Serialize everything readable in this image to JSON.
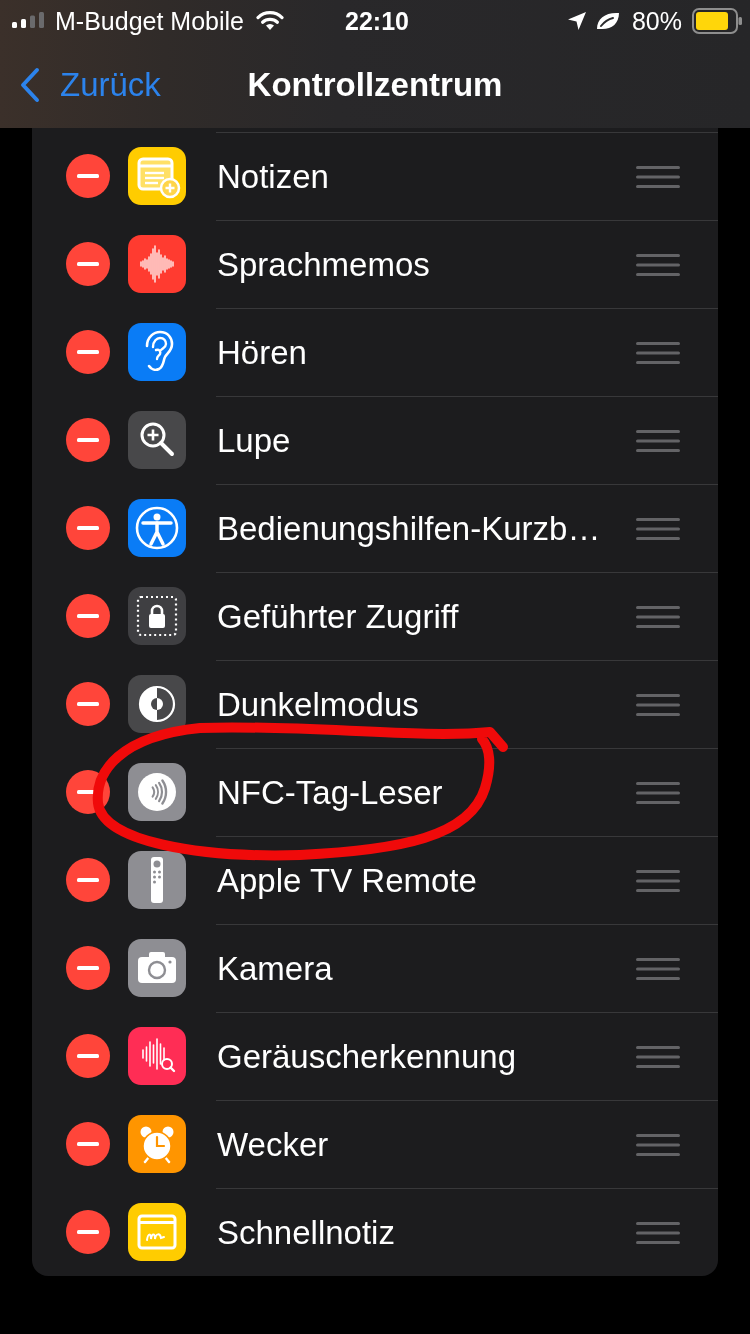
{
  "status_bar": {
    "carrier": "M-Budget Mobile",
    "time": "22:10",
    "battery": "80%"
  },
  "nav": {
    "back": "Zurück",
    "title": "Kontrollzentrum"
  },
  "items": [
    {
      "label": "Notizen",
      "kind": "notes",
      "circled": false
    },
    {
      "label": "Sprachmemos",
      "kind": "memos",
      "circled": false
    },
    {
      "label": "Hören",
      "kind": "hearing",
      "circled": false
    },
    {
      "label": "Lupe",
      "kind": "magnifier",
      "circled": false
    },
    {
      "label": "Bedienungshilfen-Kurzb…",
      "kind": "accessibility",
      "circled": false
    },
    {
      "label": "Geführter Zugriff",
      "kind": "guided",
      "circled": false
    },
    {
      "label": "Dunkelmodus",
      "kind": "darkmode",
      "circled": false
    },
    {
      "label": "NFC-Tag-Leser",
      "kind": "nfc",
      "circled": true
    },
    {
      "label": "Apple TV Remote",
      "kind": "remote",
      "circled": false
    },
    {
      "label": "Kamera",
      "kind": "camera",
      "circled": false
    },
    {
      "label": "Geräuscherkennung",
      "kind": "sound",
      "circled": false
    },
    {
      "label": "Wecker",
      "kind": "alarm",
      "circled": false
    },
    {
      "label": "Schnellnotiz",
      "kind": "quicknote",
      "circled": false
    }
  ]
}
